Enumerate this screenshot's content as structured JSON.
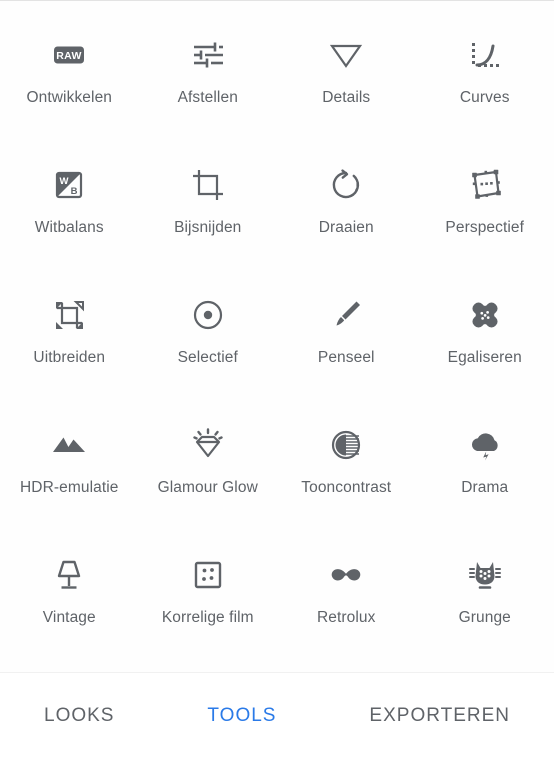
{
  "screen": {
    "name": "Snapseed Tools",
    "background_color": "#fefefe",
    "label_color": "#5f6368",
    "accent_color": "#2a7ae8"
  },
  "tools": [
    {
      "label": "Ontwikkelen",
      "icon": "raw-icon"
    },
    {
      "label": "Afstellen",
      "icon": "sliders-icon"
    },
    {
      "label": "Details",
      "icon": "triangle-down-icon"
    },
    {
      "label": "Curves",
      "icon": "curves-icon"
    },
    {
      "label": "Witbalans",
      "icon": "white-balance-icon"
    },
    {
      "label": "Bijsnijden",
      "icon": "crop-icon"
    },
    {
      "label": "Draaien",
      "icon": "rotate-icon"
    },
    {
      "label": "Perspectief",
      "icon": "perspective-icon"
    },
    {
      "label": "Uitbreiden",
      "icon": "expand-icon"
    },
    {
      "label": "Selectief",
      "icon": "selective-target-icon"
    },
    {
      "label": "Penseel",
      "icon": "brush-icon"
    },
    {
      "label": "Egaliseren",
      "icon": "healing-bandage-icon"
    },
    {
      "label": "HDR-emulatie",
      "icon": "mountains-icon"
    },
    {
      "label": "Glamour Glow",
      "icon": "diamond-sparkle-icon"
    },
    {
      "label": "Tooncontrast",
      "icon": "contrast-circle-icon"
    },
    {
      "label": "Drama",
      "icon": "storm-cloud-icon"
    },
    {
      "label": "Vintage",
      "icon": "lamp-icon"
    },
    {
      "label": "Korrelige film",
      "icon": "grain-square-icon"
    },
    {
      "label": "Retrolux",
      "icon": "mustache-icon"
    },
    {
      "label": "Grunge",
      "icon": "guitar-headstock-icon"
    }
  ],
  "tabbar": {
    "tabs": [
      {
        "label": "LOOKS",
        "active": false
      },
      {
        "label": "TOOLS",
        "active": true
      },
      {
        "label": "EXPORTEREN",
        "active": false
      }
    ]
  }
}
